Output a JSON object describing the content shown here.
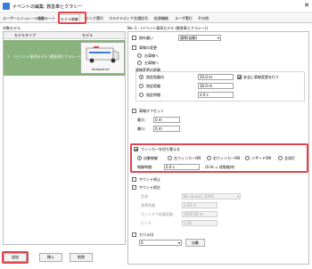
{
  "window": {
    "title": "イベントの編集: 救急車とクラシー",
    "close_label": "✕"
  },
  "tabs": [
    {
      "label": "ユーザーシミュレーション"
    },
    {
      "label": "移動ルート"
    },
    {
      "label": "モデル制御"
    },
    {
      "label": "リンク実行"
    },
    {
      "label": "マルチメディア"
    },
    {
      "label": "交通信号"
    },
    {
      "label": "拡張機能"
    },
    {
      "label": "ユーザ実行"
    },
    {
      "label": "その他"
    }
  ],
  "left": {
    "section_label": "対象モデル",
    "columns": [
      "",
      "モデルタイプ",
      "モデル"
    ],
    "rows": [
      {
        "num": "1",
        "name": "(イベント車両モデル (救急車とクラシー)",
        "thumb_caption": "Ambulance"
      }
    ],
    "buttons": {
      "add": "追加",
      "insert": "挿入",
      "delete": "削除"
    }
  },
  "right": {
    "header": "No.-1 : (イベント車両モデル (救急車とクラシー))",
    "stop": {
      "label": "指を離い",
      "combo_value": "通常(自動)"
    },
    "lane_change": {
      "label": "車線の変更",
      "opt_right": "右車線へ",
      "opt_left": "左車線へ",
      "trigger_label": "車線変更の距離",
      "opt_distance": "指定距離内",
      "distance_value": "50.0 m",
      "safe_check": "安全に車線変更を行う",
      "opt_distance2": "指定距離",
      "distance2_value": "30.0 m",
      "opt_time": "指定時間",
      "time_value": "3.0 s"
    },
    "lane_offset": {
      "label": "車線オフセット",
      "max_label": "最大:",
      "max_value": "0 m",
      "min_label": "最小:",
      "min_value": "0 m"
    },
    "winker": {
      "label": "ウィンカーを切り替える",
      "opts": [
        "自動制御",
        "左ウィンカーON",
        "右ウィンカーON",
        "ハザードON",
        "全消灯"
      ],
      "control_time_label": "制御時間:",
      "control_time_value": "0.0 s",
      "note": "(0.0s = 状態維持)"
    },
    "siren_stop": "サウンド停止",
    "siren_play": "サウンド再生",
    "sound": {
      "select_label": "音源",
      "select_value": "No sound | 100%",
      "ref_dist_label": "基準距離",
      "ref_dist_value": "1.00 m",
      "max_dist_label": "カットオフ距離距離",
      "max_dist_value": "1000.00 m",
      "pitch_label": "ピッチ",
      "pitch_value": "1.00"
    },
    "horn": {
      "label": "カウル(I)",
      "value": "0",
      "auto_button": "自動"
    }
  },
  "colors": {
    "highlight": "#e0454a",
    "selected_row": "#8ab27d"
  }
}
